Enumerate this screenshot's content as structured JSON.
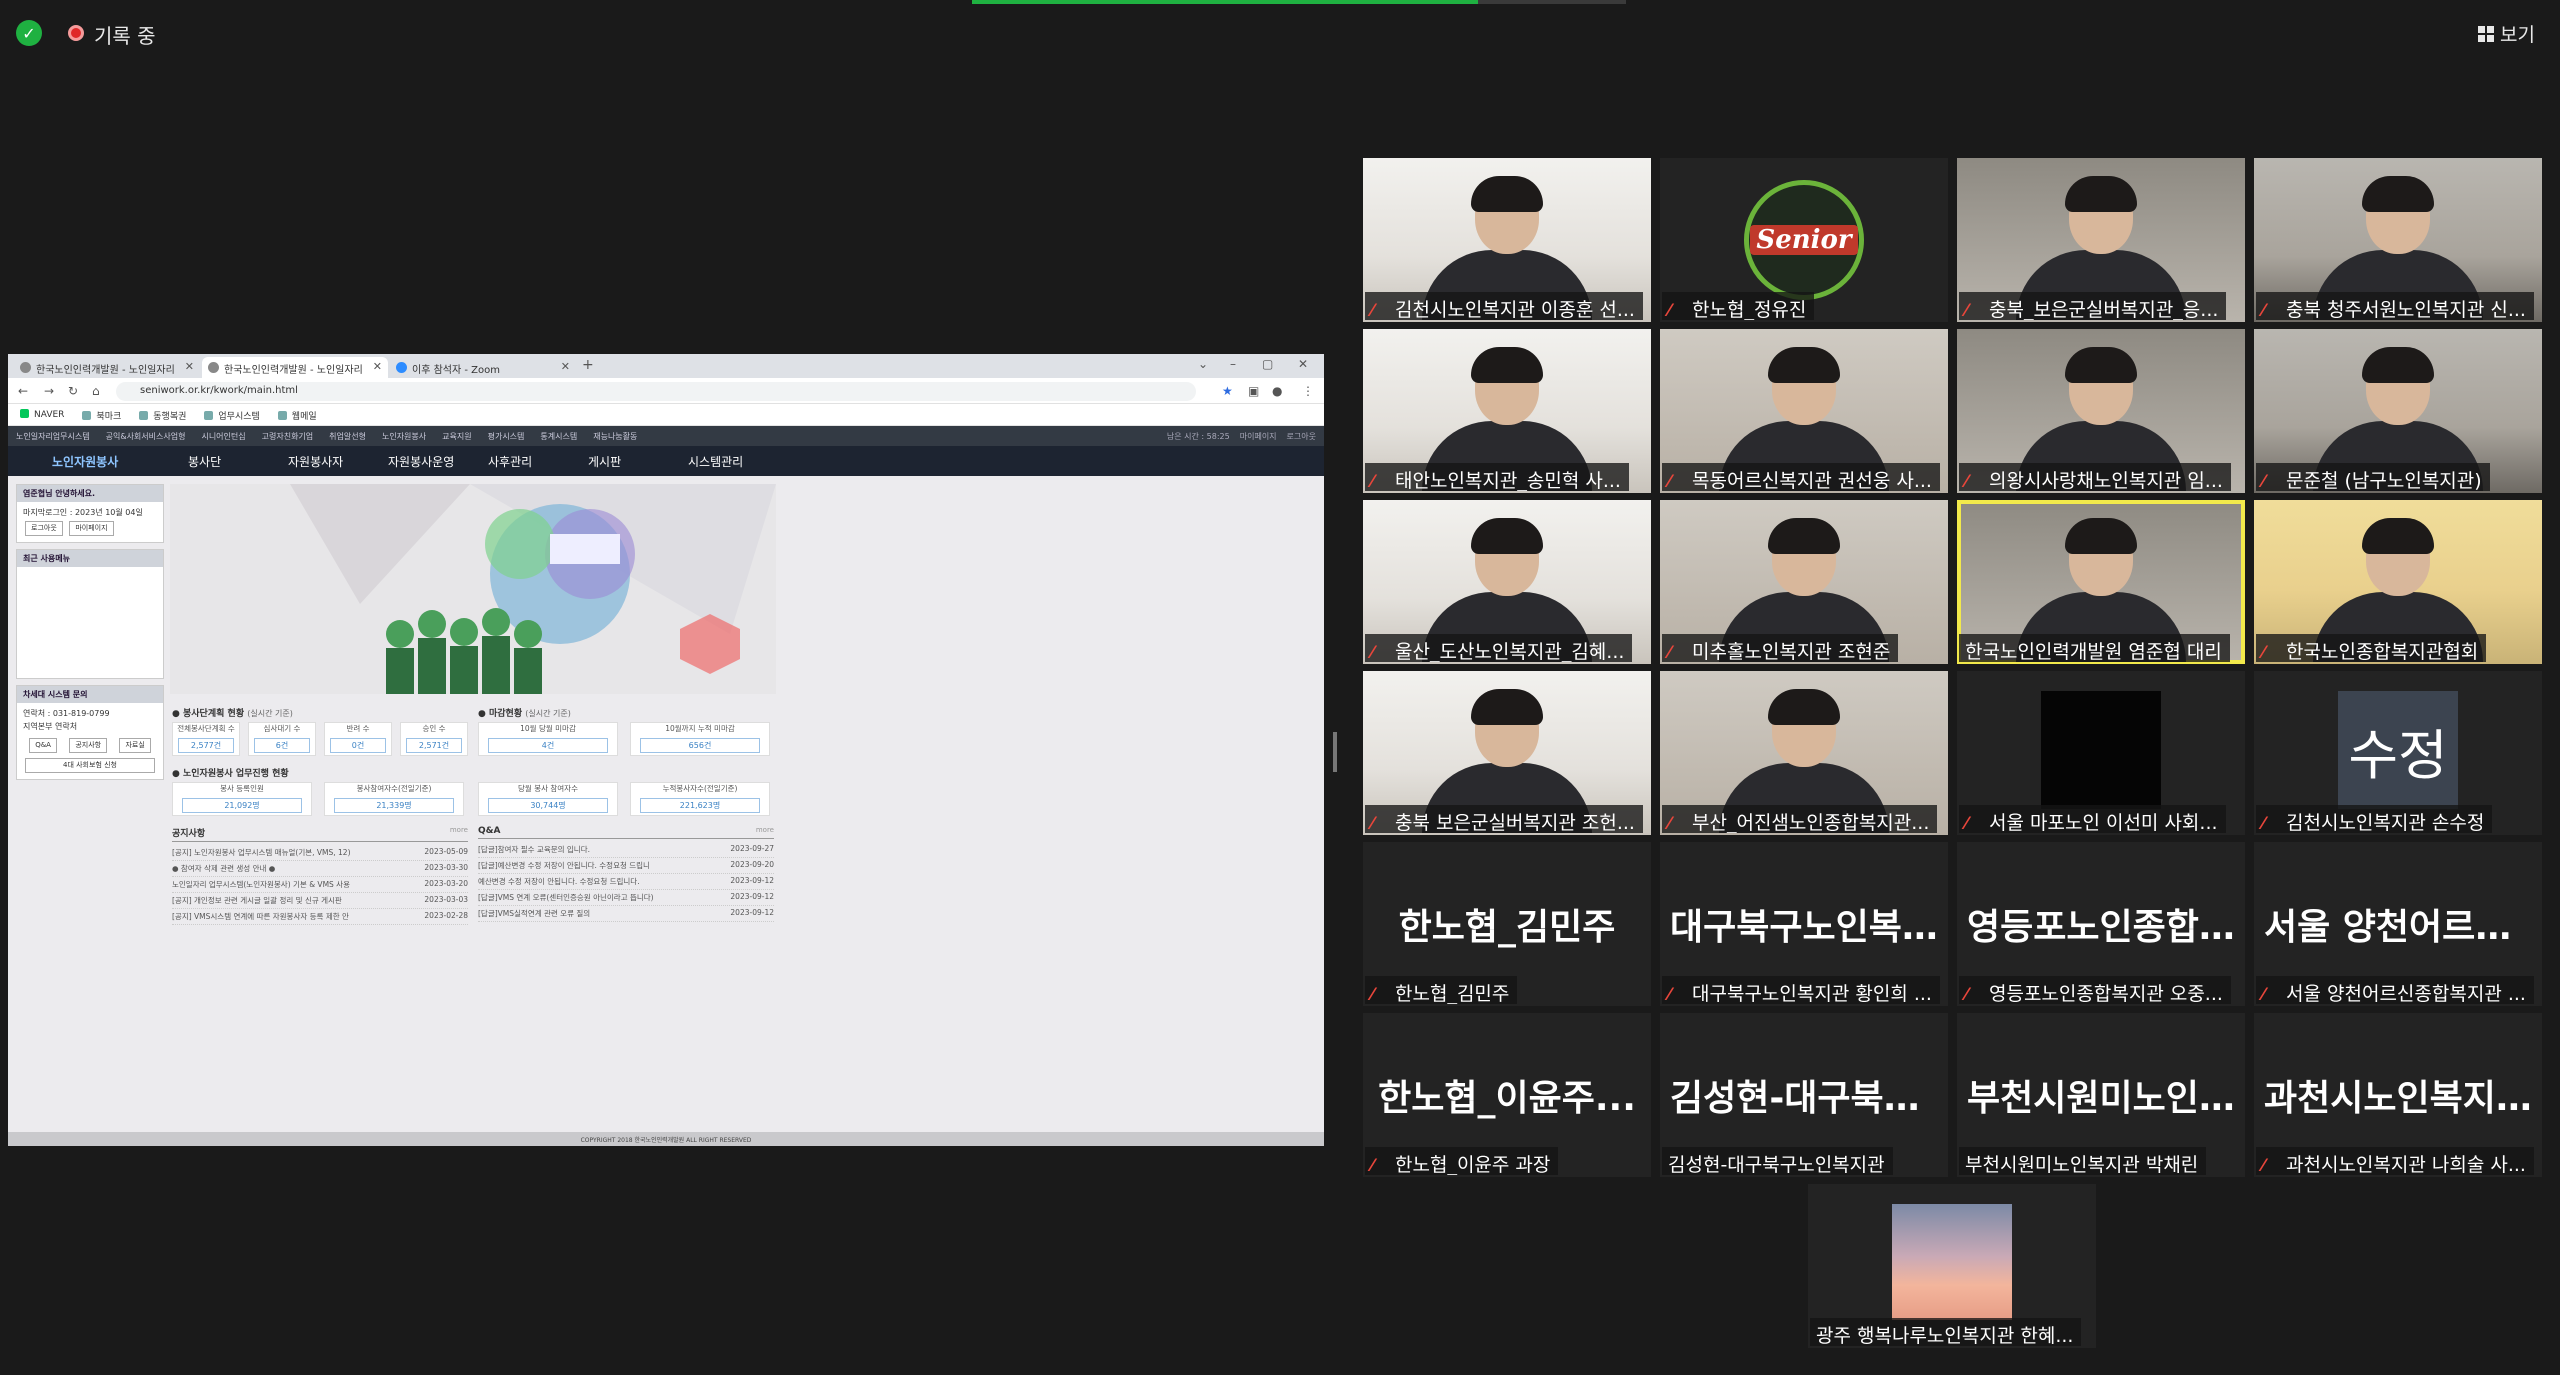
{
  "meeting": {
    "recording_label": "기록 중",
    "view_label": "보기"
  },
  "shared_screen": {
    "tabs": [
      {
        "label": "한국노인인력개발원 - 노인일자리"
      },
      {
        "label": "한국노인인력개발원 - 노인일자리"
      },
      {
        "label": "이후 참석자 - Zoom"
      }
    ],
    "url": "seniwork.or.kr/kwork/main.html",
    "bookmarks": [
      "NAVER",
      "북마크",
      "동행복권",
      "업무시스템",
      "웹메일"
    ],
    "util_links": [
      "노인일자리업무시스템",
      "공익&사회서비스사업형",
      "시니어인턴십",
      "고령자친화기업",
      "취업알선형",
      "노인자원봉사",
      "교육지원",
      "평가시스템",
      "통계시스템",
      "재능나눔활동"
    ],
    "util_right": [
      "남은 시간 : 58:25",
      "마이페이지",
      "로그아웃"
    ],
    "site_brand": "노인자원봉사",
    "menu": [
      "봉사단",
      "자원봉사자",
      "자원봉사운영",
      "사후관리",
      "게시판",
      "시스템관리"
    ],
    "login_panel": {
      "greeting": "염준협님 안녕하세요.",
      "last_login": "마지막로그인 : 2023년 10월 04일",
      "logout": "로그아웃",
      "mypage": "마이페이지"
    },
    "recent_menu_title": "최근 사용메뉴",
    "help_panel": {
      "title": "차세대 시스템 문의",
      "contact": "연락처 : 031-819-0799",
      "phone_dir": "지역본부 연락처",
      "icons": [
        "Q&A",
        "공지사항",
        "자료실"
      ],
      "cert_btn": "4대 사회보험 신청"
    },
    "plan_section": {
      "title": "봉사단계획 현황",
      "sub": "(실시간 기준)"
    },
    "deadline_section": {
      "title": "마감현황",
      "sub": "(실시간 기준)"
    },
    "plan_stats": [
      {
        "label": "전체봉사단계획 수",
        "value": "2,577건"
      },
      {
        "label": "심사대기 수",
        "value": "6건"
      },
      {
        "label": "반려 수",
        "value": "0건"
      },
      {
        "label": "승인 수",
        "value": "2,571건"
      }
    ],
    "deadline_stats": [
      {
        "label": "10월 당월 미마감",
        "value": "4건"
      },
      {
        "label": "10월까지 누적 미마감",
        "value": "656건"
      }
    ],
    "ops_section": {
      "title": "노인자원봉사 업무진행 현황",
      "sub": ""
    },
    "ops_stats": [
      {
        "label": "봉사 등록인원",
        "value": "21,092명"
      },
      {
        "label": "봉사참여자수(전일기준)",
        "value": "21,339명"
      },
      {
        "label": "당월 봉사 참여자수",
        "value": "30,744명"
      },
      {
        "label": "누적봉사자수(전일기준)",
        "value": "221,623명"
      }
    ],
    "notice": {
      "title": "공지사항",
      "more": "more",
      "rows": [
        {
          "text": "[공지] 노인자원봉사 업무시스템 매뉴얼(기본, VMS, 12)",
          "date": "2023-05-09"
        },
        {
          "text": "● 참여자 삭제 관련 생성 안내 ●",
          "date": "2023-03-30"
        },
        {
          "text": "노인일자리 업무시스템(노인자원봉사) 기본 & VMS 사용",
          "date": "2023-03-20"
        },
        {
          "text": "[공지] 개인정보 관련 게시글 일괄 정리 및 신규 게시판",
          "date": "2023-03-03"
        },
        {
          "text": "[공지] VMS시스템 연계에 따른 자원봉사자 등록 제한 안",
          "date": "2023-02-28"
        }
      ]
    },
    "qna": {
      "title": "Q&A",
      "more": "more",
      "rows": [
        {
          "text": "[답글]참여자 필수 교육문의 입니다.",
          "date": "2023-09-27"
        },
        {
          "text": "[답글]예산변경 수정 저장이 안됩니다. 수정요청 드립니",
          "date": "2023-09-20"
        },
        {
          "text": "예산변경 수정 저장이 안됩니다. 수정요청 드립니다.",
          "date": "2023-09-12"
        },
        {
          "text": "[답글]VMS 연계 오류(센터인증승원 아닌이라고 뜹니다)",
          "date": "2023-09-12"
        },
        {
          "text": "[답글]VMS실적연계 관련 오류 질의",
          "date": "2023-09-12"
        }
      ]
    },
    "footer": "COPYRIGHT 2018 한국노인인력개발원 ALL RIGHT RESERVED"
  },
  "participants": [
    {
      "name": "김천시노인복지관 이종훈 선...",
      "muted": true,
      "kind": "video"
    },
    {
      "name": "한노협_정유진",
      "muted": true,
      "kind": "logo"
    },
    {
      "name": "충북_보은군실버복지관_응...",
      "muted": true,
      "kind": "video"
    },
    {
      "name": "충북 청주서원노인복지관 신...",
      "muted": true,
      "kind": "video"
    },
    {
      "name": "태안노인복지관_송민혁 사...",
      "muted": true,
      "kind": "video"
    },
    {
      "name": "목동어르신복지관 권선웅 사...",
      "muted": true,
      "kind": "video"
    },
    {
      "name": "의왕시사랑채노인복지관 임...",
      "muted": true,
      "kind": "video"
    },
    {
      "name": "문준철 (남구노인복지관)",
      "muted": true,
      "kind": "video"
    },
    {
      "name": "울산_도산노인복지관_김혜...",
      "muted": true,
      "kind": "video"
    },
    {
      "name": "미추홀노인복지관 조현준",
      "muted": true,
      "kind": "video"
    },
    {
      "name": "한국노인인력개발원 염준협 대리",
      "muted": false,
      "kind": "video",
      "active": true
    },
    {
      "name": "한국노인종합복지관협회",
      "muted": true,
      "kind": "video"
    },
    {
      "name": "충북 보은군실버복지관 조헌...",
      "muted": true,
      "kind": "video"
    },
    {
      "name": "부산_어진샘노인종합복지관...",
      "muted": true,
      "kind": "video"
    },
    {
      "name": "서울 마포노인 이선미 사회...",
      "muted": true,
      "kind": "black"
    },
    {
      "name": "김천시노인복지관 손수정",
      "muted": true,
      "kind": "avatar",
      "avatar": "수정"
    },
    {
      "name": "한노협_김민주",
      "muted": true,
      "kind": "text",
      "big": "한노협_김민주"
    },
    {
      "name": "대구북구노인복지관 황인희 ...",
      "muted": true,
      "kind": "text",
      "big": "대구북구노인복..."
    },
    {
      "name": "영등포노인종합복지관 오중...",
      "muted": true,
      "kind": "text",
      "big": "영등포노인종합..."
    },
    {
      "name": "서울 양천어르신종합복지관 ...",
      "muted": true,
      "kind": "text",
      "big": "서울 양천어르신..."
    },
    {
      "name": "한노협_이윤주 과장",
      "muted": true,
      "kind": "text",
      "big": "한노협_이윤주..."
    },
    {
      "name": "김성현-대구북구노인복지관",
      "muted": false,
      "kind": "text",
      "big": "김성현-대구북구..."
    },
    {
      "name": "부천시원미노인복지관 박채린",
      "muted": false,
      "kind": "text",
      "big": "부천시원미노인..."
    },
    {
      "name": "과천시노인복지관 나희술 사...",
      "muted": true,
      "kind": "text",
      "big": "과천시노인복지..."
    },
    {
      "name": "광주 행복나루노인복지관 한혜...",
      "muted": false,
      "kind": "sky"
    }
  ],
  "colors": {
    "muted_mic": "#e8463b",
    "active_speaker": "#f2e94b",
    "recording": "#e02828",
    "secure": "#1fb141"
  }
}
